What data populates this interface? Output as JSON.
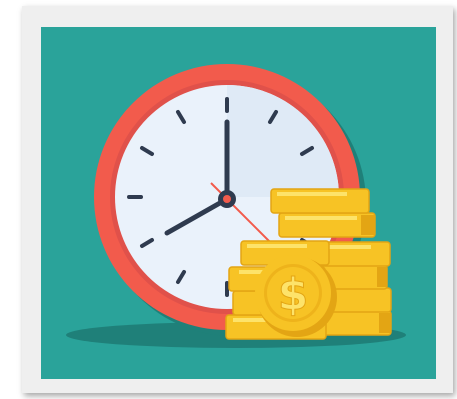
{
  "illustration": {
    "subject": "clock-and-coin-stacks",
    "icons": [
      "clock-icon",
      "coin-stack-icon",
      "dollar-coin-icon"
    ],
    "colors": {
      "frame": "#efefef",
      "background": "#2aa39a",
      "clock_rim": "#f25b4c",
      "clock_face": "#eaf2fb",
      "clock_hands": "#2f3b4f",
      "second_hand": "#f25b4c",
      "coin_gold": "#f7c325",
      "coin_shadow": "#e3a514",
      "coin_highlight": "#fde36a"
    }
  }
}
